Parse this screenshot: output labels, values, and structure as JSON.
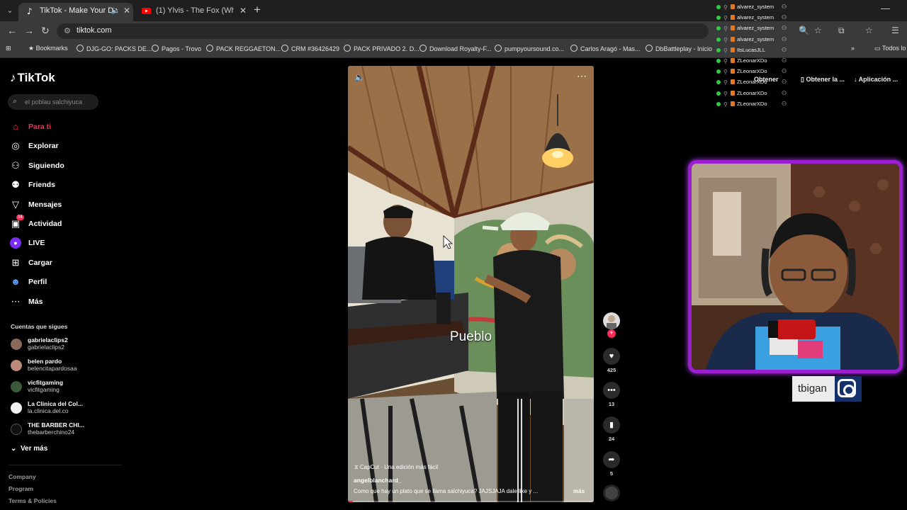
{
  "browser": {
    "tabs": [
      {
        "title": "TikTok - Make Your Day",
        "active": true
      },
      {
        "title": "(1) Ylvis - The Fox (What Does",
        "active": false
      }
    ],
    "url": "tiktok.com",
    "bookmarks": [
      "Bookmarks",
      "DJG-GO: PACKS DE...",
      "Pagos - Trovo",
      "PACK REGGAETON...",
      "CRM #36426429",
      "PACK PRIVADO 2. D...",
      "Download Royalty-F...",
      "pumpyoursound.co...",
      "Carlos Aragó - Mas...",
      "DbBattleplay - Inicio"
    ],
    "bookmarks_all": "Todos lo",
    "extensions": [
      "Obtener la ...",
      "Aplicación ..."
    ],
    "obtener_short": "Obtener"
  },
  "viewers": [
    "alvarez_system",
    "alvarez_system",
    "alvarez_system",
    "alvarez_system",
    "ItsLucasJLL",
    "ZLeonarXDo",
    "ZLeonarXDo",
    "ZLeonarXDo",
    "ZLeonarXDo",
    "ZLeonarXDo"
  ],
  "sidebar": {
    "logo": "TikTok",
    "search_placeholder": "el poblau salchiyuca",
    "nav": [
      {
        "label": "Para ti",
        "icon": "home-icon",
        "active": true
      },
      {
        "label": "Explorar",
        "icon": "compass-icon"
      },
      {
        "label": "Siguiendo",
        "icon": "following-icon"
      },
      {
        "label": "Friends",
        "icon": "friends-icon"
      },
      {
        "label": "Mensajes",
        "icon": "messages-icon"
      },
      {
        "label": "Actividad",
        "icon": "activity-icon",
        "badge": "34"
      },
      {
        "label": "LIVE",
        "icon": "live-icon"
      },
      {
        "label": "Cargar",
        "icon": "upload-icon"
      },
      {
        "label": "Perfil",
        "icon": "profile-icon"
      },
      {
        "label": "Más",
        "icon": "more-icon"
      }
    ],
    "following_title": "Cuentas que sigues",
    "following": [
      {
        "name": "gabrielaclips2",
        "handle": "gabrielaclips2"
      },
      {
        "name": "belen pardo",
        "handle": "belencitapardosaa"
      },
      {
        "name": "vicfitgaming",
        "handle": "vicfitgaming"
      },
      {
        "name": "La Clinica del Col...",
        "handle": "la.clinica.del.co"
      },
      {
        "name": "THE BARBER CHI...",
        "handle": "thebarberchino24"
      }
    ],
    "see_more": "Ver más",
    "footer": [
      "Company",
      "Program",
      "Terms & Policies"
    ]
  },
  "video": {
    "caption_word": "Pueblo",
    "capcut": "CapCut · Una edición más fácil",
    "author": "angelblanchard_",
    "description": "Como que hay un plato que se llama salchiyuca? JAJSJAJA dale like y ...",
    "more": "más",
    "progress": 0.02
  },
  "actions": {
    "likes": "425",
    "comments": "13",
    "saves": "24",
    "shares": "5"
  },
  "stream": {
    "handle": "tbigan"
  }
}
